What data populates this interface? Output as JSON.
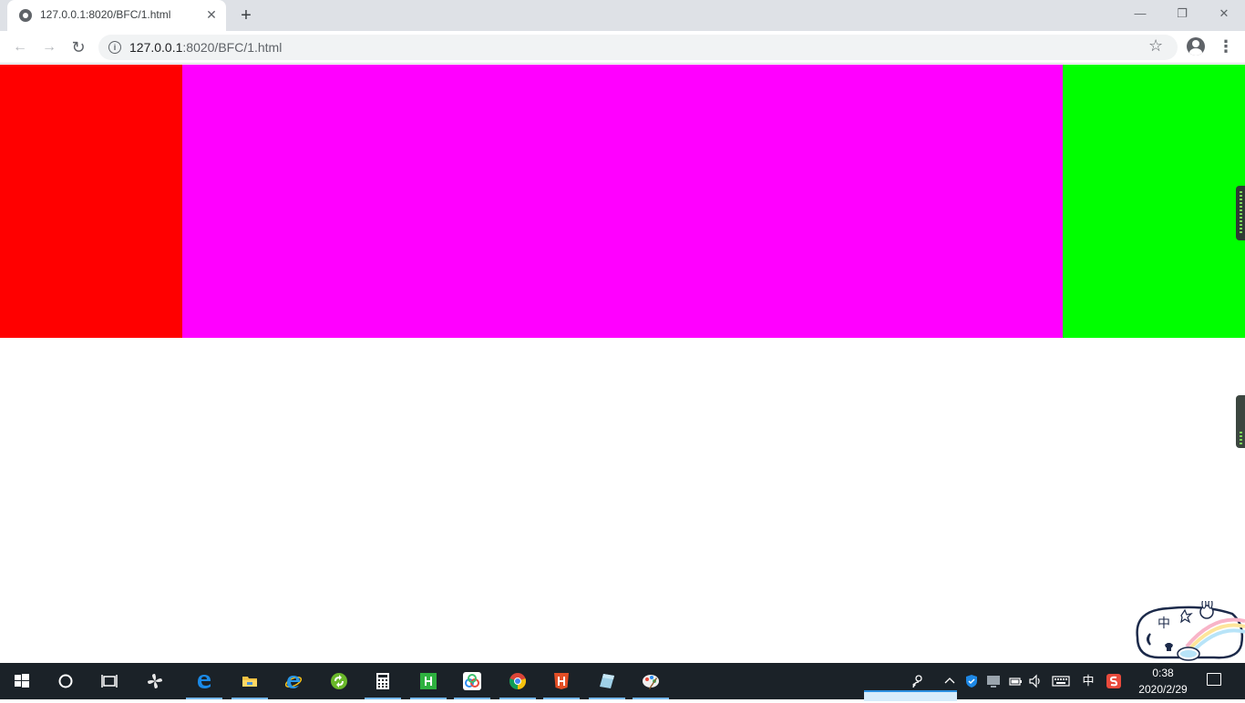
{
  "browser": {
    "tab": {
      "title": "127.0.0.1:8020/BFC/1.html",
      "close_glyph": "✕"
    },
    "new_tab_glyph": "+",
    "window_controls": {
      "minimize": "—",
      "restore": "❐",
      "close": "✕"
    },
    "nav": {
      "back_glyph": "←",
      "forward_glyph": "→",
      "reload_glyph": "↻"
    },
    "address": {
      "host": "127.0.0.1",
      "path": ":8020/BFC/1.html"
    },
    "bookmark_glyph": "☆",
    "menu_glyph": "⋮"
  },
  "page": {
    "boxes": [
      {
        "name": "left",
        "color": "#ff0000"
      },
      {
        "name": "middle",
        "color": "#ff00ff"
      },
      {
        "name": "right",
        "color": "#00ff00"
      }
    ]
  },
  "sticker": {
    "label": "中"
  },
  "taskbar": {
    "ime_label": "中",
    "clock_time": "0:38",
    "clock_date": "2020/2/29",
    "apps": [
      {
        "name": "start",
        "icon": "windows-icon"
      },
      {
        "name": "search",
        "icon": "cortana-icon"
      },
      {
        "name": "task-view",
        "icon": "task-view-icon"
      },
      {
        "name": "pinwheel",
        "icon": "pinwheel-icon"
      },
      {
        "name": "edge",
        "icon": "edge-icon"
      },
      {
        "name": "file-explorer",
        "icon": "folder-icon"
      },
      {
        "name": "internet-explorer",
        "icon": "ie-icon"
      },
      {
        "name": "app-green-refresh",
        "icon": "refresh-app-icon"
      },
      {
        "name": "calculator",
        "icon": "calculator-icon"
      },
      {
        "name": "hbuilder",
        "icon": "hbuilder-icon"
      },
      {
        "name": "baidu-netdisk",
        "icon": "netdisk-icon"
      },
      {
        "name": "chrome",
        "icon": "chrome-icon"
      },
      {
        "name": "html5-app",
        "icon": "html5-icon"
      },
      {
        "name": "notes-app",
        "icon": "notes-icon"
      },
      {
        "name": "paint-app",
        "icon": "paint-icon"
      }
    ]
  }
}
